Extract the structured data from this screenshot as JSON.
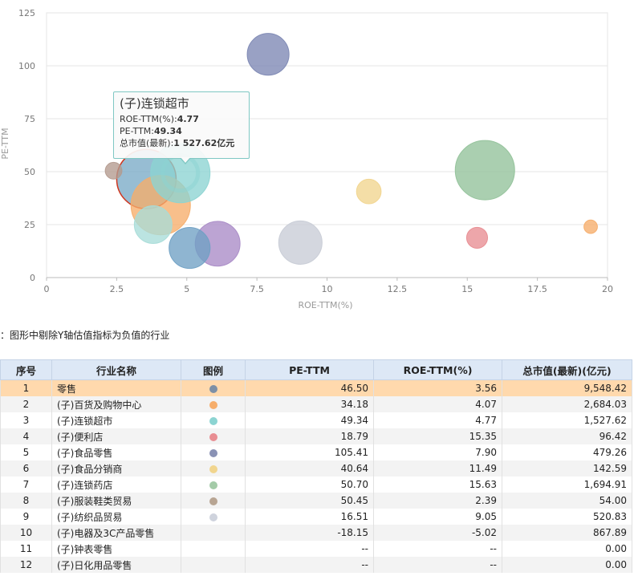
{
  "chart_data": {
    "type": "scatter",
    "xlabel": "ROE-TTM(%)",
    "ylabel": "PE-TTM",
    "xlim": [
      0,
      20
    ],
    "ylim": [
      0,
      125
    ],
    "x_ticks": [
      "0",
      "2.5",
      "5",
      "7.5",
      "10",
      "12.5",
      "15",
      "17.5",
      "20"
    ],
    "y_ticks": [
      "0",
      "25",
      "50",
      "75",
      "100",
      "125"
    ],
    "grid": "horizontal",
    "points": [
      {
        "x": 3.56,
        "y": 46.5,
        "size": 9548.42,
        "color": "#7aaac6",
        "highlight": true
      },
      {
        "x": 4.07,
        "y": 34.18,
        "size": 2684.03,
        "color": "#f6ad6a"
      },
      {
        "x": 4.77,
        "y": 49.34,
        "size": 1527.62,
        "color": "#8cd4d2"
      },
      {
        "x": 15.35,
        "y": 18.79,
        "size": 96.42,
        "color": "#e88d92"
      },
      {
        "x": 7.9,
        "y": 105.41,
        "size": 479.26,
        "color": "#7c87b3"
      },
      {
        "x": 11.49,
        "y": 40.64,
        "size": 142.59,
        "color": "#f1d58e"
      },
      {
        "x": 15.63,
        "y": 50.7,
        "size": 1694.91,
        "color": "#92c29a"
      },
      {
        "x": 2.39,
        "y": 50.45,
        "size": 54.0,
        "color": "#b39a8e"
      },
      {
        "x": 9.05,
        "y": 16.51,
        "size": 520.83,
        "color": "#c8ccd6"
      },
      {
        "x": 3.8,
        "y": 25.0,
        "size": 380.0,
        "color": "#a8dcd8"
      },
      {
        "x": 5.1,
        "y": 14.0,
        "size": 460.0,
        "color": "#6fa0c4"
      },
      {
        "x": 6.1,
        "y": 16.0,
        "size": 560.0,
        "color": "#a98bc6"
      },
      {
        "x": 19.4,
        "y": 24.0,
        "size": 30.0,
        "color": "#f6ad6a"
      }
    ]
  },
  "tooltip": {
    "title": "(子)连锁超市",
    "roe_label": "ROE-TTM(%):",
    "roe_value": "4.77",
    "pe_label": "PE-TTM:",
    "pe_value": "49.34",
    "mcap_label": "总市值(最新):",
    "mcap_value": "1 527.62亿元"
  },
  "note": "：图形中剔除Y轴估值指标为负值的行业",
  "table": {
    "headers": [
      "序号",
      "行业名称",
      "图例",
      "PE-TTM",
      "ROE-TTM(%)",
      "总市值(最新)(亿元)"
    ],
    "rows": [
      {
        "idx": "1",
        "name": "零售",
        "color": "#7c8fa6",
        "pe": "46.50",
        "roe": "3.56",
        "mcap": "9,548.42"
      },
      {
        "idx": "2",
        "name": "(子)百货及购物中心",
        "color": "#f6ad6a",
        "pe": "34.18",
        "roe": "4.07",
        "mcap": "2,684.03"
      },
      {
        "idx": "3",
        "name": "(子)连锁超市",
        "color": "#8cd4d2",
        "pe": "49.34",
        "roe": "4.77",
        "mcap": "1,527.62"
      },
      {
        "idx": "4",
        "name": "(子)便利店",
        "color": "#e88d92",
        "pe": "18.79",
        "roe": "15.35",
        "mcap": "96.42"
      },
      {
        "idx": "5",
        "name": "(子)食品零售",
        "color": "#8a92b5",
        "pe": "105.41",
        "roe": "7.90",
        "mcap": "479.26"
      },
      {
        "idx": "6",
        "name": "(子)食品分销商",
        "color": "#f1d58e",
        "pe": "40.64",
        "roe": "11.49",
        "mcap": "142.59"
      },
      {
        "idx": "7",
        "name": "(子)连锁药店",
        "color": "#a4cba8",
        "pe": "50.70",
        "roe": "15.63",
        "mcap": "1,694.91"
      },
      {
        "idx": "8",
        "name": "(子)服装鞋类贸易",
        "color": "#b8a593",
        "pe": "50.45",
        "roe": "2.39",
        "mcap": "54.00"
      },
      {
        "idx": "9",
        "name": "(子)纺织品贸易",
        "color": "#cfd3dd",
        "pe": "16.51",
        "roe": "9.05",
        "mcap": "520.83"
      },
      {
        "idx": "10",
        "name": "(子)电器及3C产品零售",
        "color": "",
        "pe": "-18.15",
        "roe": "-5.02",
        "mcap": "867.89"
      },
      {
        "idx": "11",
        "name": "(子)钟表零售",
        "color": "",
        "pe": "--",
        "roe": "--",
        "mcap": "0.00"
      },
      {
        "idx": "12",
        "name": "(子)日化用品零售",
        "color": "",
        "pe": "--",
        "roe": "--",
        "mcap": "0.00"
      }
    ]
  }
}
